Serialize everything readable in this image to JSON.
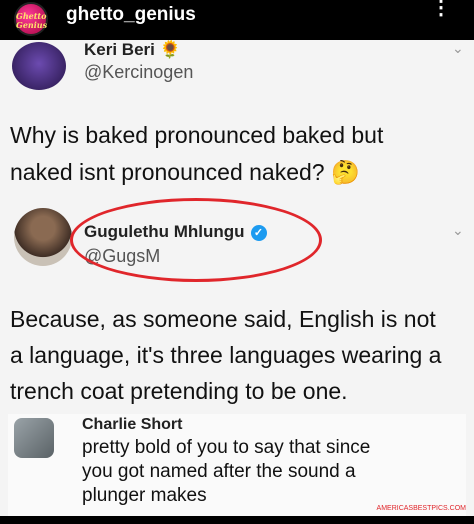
{
  "header": {
    "username": "ghetto_genius",
    "avatar_text": "Ghetto Genius",
    "menu_glyph": "⋮"
  },
  "tweet1": {
    "author_name": "Keri Beri 🌻",
    "handle": "@Kercinogen",
    "text_line1": "Why is baked pronounced baked but",
    "text_line2": "naked isnt pronounced naked? 🤔"
  },
  "tweet2": {
    "author_name": "Gugulethu Mhlungu",
    "verified_glyph": "✓",
    "handle": "@GugsM",
    "text_line1": "Because, as someone said, English is not",
    "text_line2": "a language, it's three languages wearing a",
    "text_line3": "trench coat pretending to be one."
  },
  "reply": {
    "author_name": "Charlie Short",
    "text_line1": "pretty bold of you to say that since",
    "text_line2": "you got named after the sound a",
    "text_line3": "plunger makes"
  },
  "chevron_glyph": "⌄",
  "watermark": "AMERICASBESTPICS.COM",
  "colors": {
    "highlight_circle": "#e0262b",
    "verified": "#1d9bf0"
  }
}
